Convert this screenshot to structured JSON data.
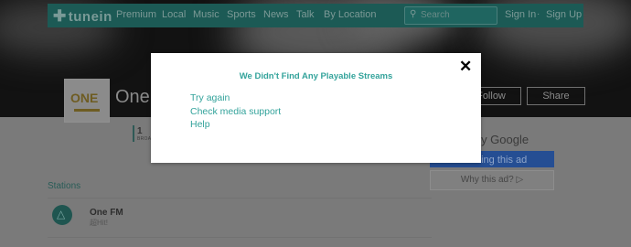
{
  "nav": {
    "logo": "tunein",
    "items": [
      "Premium",
      "Local",
      "Music",
      "Sports",
      "News",
      "Talk",
      "By Location"
    ],
    "search_placeholder": "Search",
    "sign_in": "Sign In",
    "separator": "·",
    "sign_up": "Sign Up"
  },
  "station": {
    "logo_text": "ONE",
    "title": "One F",
    "follow": "Follow",
    "share": "Share",
    "stat_number": "1",
    "stat_label": "BROA"
  },
  "ad": {
    "by_google": "d by Google",
    "bar_text": "eing this ad",
    "why": "Why this ad? ▷"
  },
  "stations": {
    "heading": "Stations",
    "items": [
      {
        "name": "One FM",
        "subtitle": "超Hit!"
      }
    ]
  },
  "modal": {
    "title": "We Didn't Find Any Playable Streams",
    "close_glyph": "✕",
    "links": [
      "Try again",
      "Check media support",
      "Help"
    ]
  }
}
